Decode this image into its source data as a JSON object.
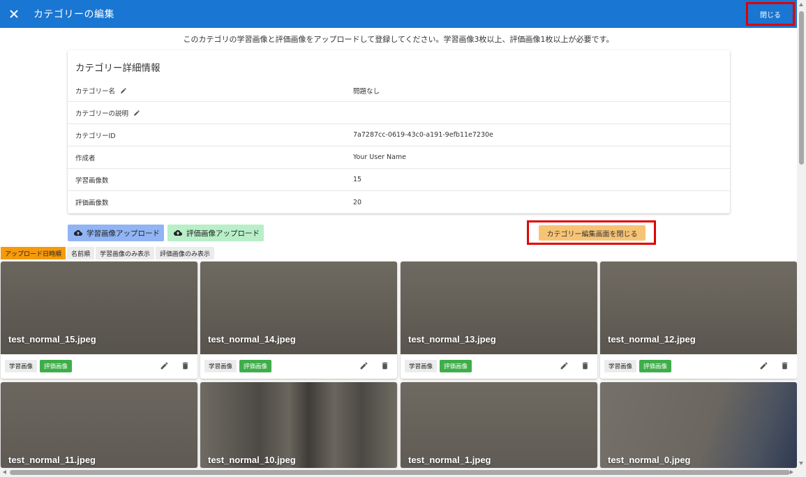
{
  "header": {
    "title": "カテゴリーの編集",
    "close_label": "閉じる"
  },
  "instruction": "このカテゴリの学習画像と評価画像をアップロードして登録してください。学習画像3枚以上、評価画像1枚以上が必要です。",
  "details": {
    "title": "カテゴリー詳細情報",
    "rows": [
      {
        "label": "カテゴリー名",
        "value": "問題なし"
      },
      {
        "label": "カテゴリーの説明",
        "value": ""
      },
      {
        "label": "カテゴリーID",
        "value": "7a7287cc-0619-43c0-a191-9efb11e7230e"
      },
      {
        "label": "作成者",
        "value": "Your User Name"
      },
      {
        "label": "学習画像数",
        "value": "15"
      },
      {
        "label": "評価画像数",
        "value": "20"
      }
    ]
  },
  "buttons": {
    "upload_train": "学習画像アップロード",
    "upload_eval": "評価画像アップロード",
    "close_edit": "カテゴリー編集画面を閉じる"
  },
  "sort_tabs": [
    "アップロード日時順",
    "名前順",
    "学習画像のみ表示",
    "評価画像のみ表示"
  ],
  "images": [
    {
      "name": "test_normal_15.jpeg",
      "train_chip": "学習画像",
      "eval_chip": "評価画像"
    },
    {
      "name": "test_normal_14.jpeg",
      "train_chip": "学習画像",
      "eval_chip": "評価画像"
    },
    {
      "name": "test_normal_13.jpeg",
      "train_chip": "学習画像",
      "eval_chip": "評価画像"
    },
    {
      "name": "test_normal_12.jpeg",
      "train_chip": "学習画像",
      "eval_chip": "評価画像"
    },
    {
      "name": "test_normal_11.jpeg"
    },
    {
      "name": "test_normal_10.jpeg"
    },
    {
      "name": "test_normal_1.jpeg"
    },
    {
      "name": "test_normal_0.jpeg"
    }
  ],
  "colors": {
    "appbar": "#1976d2",
    "highlight_border": "#e00000",
    "upload_train_bg": "#90b4f4",
    "upload_eval_bg": "#b8efc8",
    "close_edit_bg": "#f7c476",
    "active_sort_bg": "#f59a0c",
    "eval_chip_bg": "#3fae4a"
  },
  "icons": [
    "close-icon",
    "pencil-icon",
    "cloud-upload-icon",
    "edit-icon",
    "delete-icon"
  ]
}
